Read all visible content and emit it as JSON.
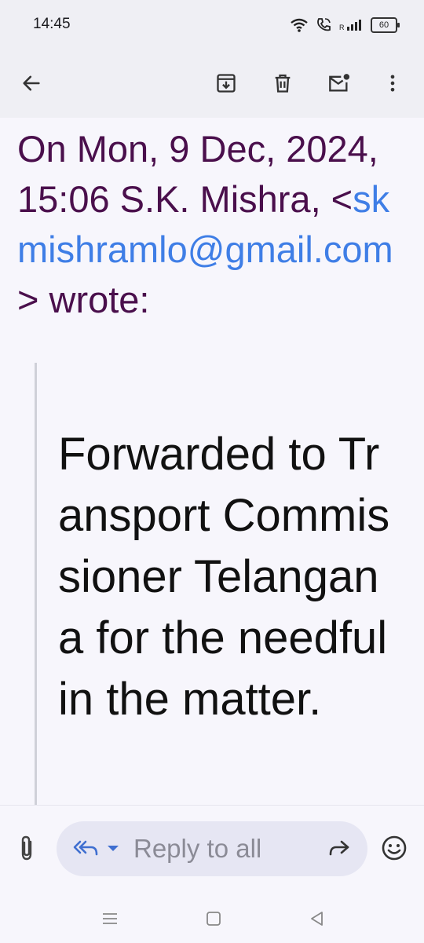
{
  "status_bar": {
    "time": "14:45",
    "battery": "60",
    "icons": [
      "wifi-icon",
      "wifi-call-icon",
      "signal-icon",
      "battery-icon"
    ]
  },
  "toolbar": {
    "icons": [
      "back-arrow-icon",
      "archive-icon",
      "delete-icon",
      "mark-unread-icon",
      "more-vert-icon"
    ]
  },
  "email": {
    "quote_header_prefix": "On Mon, 9 Dec, 2024, 15:06 S.K. Mishra, <",
    "quote_email": "skmishramlo@gmail.com",
    "quote_header_suffix": "> wrote:",
    "quoted_body": "Forwarded to Transport Commissioner Telangana for the needful in the matter."
  },
  "reply": {
    "placeholder": "Reply to all",
    "icons": [
      "attach-icon",
      "reply-all-icon",
      "caret-down-icon",
      "forward-icon",
      "emoji-icon"
    ]
  },
  "colors": {
    "quote_header": "#4a0f4c",
    "link": "#3f7ee6",
    "toolbar_bg": "#efeff4",
    "reply_pill_bg": "#e6e6f3"
  }
}
